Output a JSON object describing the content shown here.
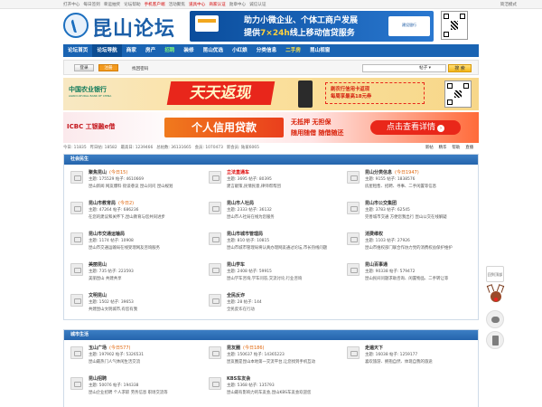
{
  "topbar": {
    "links": [
      "打开中心",
      "每日签到",
      "幸运抽奖",
      "论坛帮助",
      "手机客户端",
      "活动聚焦",
      "道具中心",
      "商家认证",
      "勋章中心",
      "诚信认证"
    ],
    "hot": [
      4,
      6,
      7
    ],
    "right_label": "简洁模式"
  },
  "header": {
    "logo_text": "昆山论坛",
    "banner_line1": "助力小微企业、个体工商户发展",
    "banner_line2_pre": "提供",
    "banner_line2_hl": "7×24h",
    "banner_line2_post": "线上移动信贷服务",
    "banner_bank": "建设银行"
  },
  "nav": {
    "items": [
      {
        "label": "论坛首页",
        "style": ""
      },
      {
        "label": "论坛导航",
        "style": "on"
      },
      {
        "label": "商家",
        "style": ""
      },
      {
        "label": "房产",
        "style": ""
      },
      {
        "label": "招聘",
        "style": "green"
      },
      {
        "label": "装修",
        "style": ""
      },
      {
        "label": "昆山优选",
        "style": ""
      },
      {
        "label": "小红娘",
        "style": ""
      },
      {
        "label": "分类信息",
        "style": ""
      },
      {
        "label": "二手房",
        "style": "yellow"
      },
      {
        "label": "昆山视窗",
        "style": ""
      }
    ]
  },
  "search": {
    "login_label": "登录",
    "register_label": "注册",
    "forgot_label": "找回密码",
    "select_label": "帖子",
    "button_label": "搜 索"
  },
  "ads": {
    "abc_name": "中国农业银行",
    "abc_en": "AGRICULTURAL BANK OF CHINA",
    "abc_headline": "天天返现",
    "abc_line1": "刷农行信用卡返现",
    "abc_line2": "每周享最高18元券",
    "icbc_name": "ICBC 工银融e借",
    "icbc_sub": "",
    "icbc_headline": "个人信用贷款",
    "icbc_slogan1": "无抵押 无担保",
    "icbc_slogan2": "随用随借 随借随还",
    "icbc_cta": "点击查看详情"
  },
  "stats": {
    "today": "今日: 11835",
    "yesterday": "昨日帖: 18582",
    "max": "最高日: 1239466",
    "posts": "总帖数: 36131665",
    "members": "会员: 1070473",
    "new_member": "新会员: 陆家6065",
    "links": [
      "新帖",
      "精华",
      "帮助",
      "直播"
    ]
  },
  "sections": [
    {
      "title": "社会民生",
      "forums": [
        {
          "name": "聚焦昆山",
          "today": "(今日15)",
          "red": false,
          "stat": "主题: 175529  帖子: 4610669",
          "desc": "昆山新闻 网友爆料 街谈巷议 昆山问问 昆山规划"
        },
        {
          "name": "立法直通车",
          "today": "",
          "red": true,
          "stat": "主题: 3695  帖子: 80395",
          "desc": "建言献策,民情民意,律师帮帮团"
        },
        {
          "name": "昆山分类信息",
          "today": "(今日1947)",
          "red": false,
          "stat": "主题: 9155  帖子: 1838576",
          "desc": "房屋租售、招聘、寻事、二手闲置等信息"
        },
        {
          "name": "昆山市教育局",
          "today": "(今日2)",
          "red": false,
          "stat": "主题: 47264  帖子: 686236",
          "desc": "在您的建议和关怀下,昆山教育与您共同进步"
        },
        {
          "name": "昆山市人社局",
          "today": "",
          "red": false,
          "stat": "主题: 2333  帖子: 36132",
          "desc": "昆山市人社局在线为您服务"
        },
        {
          "name": "昆山市公交集团",
          "today": "",
          "red": false,
          "stat": "主题: 3783  帖子: 62545",
          "desc": "完善城市交通 方便您我出行 昆山公交在线解疑"
        },
        {
          "name": "昆山市交通运输局",
          "today": "",
          "red": false,
          "stat": "主题: 1174  帖子: 10908",
          "desc": "昆山市交通运输局在线受理网友咨询服务"
        },
        {
          "name": "昆山市城市管理局",
          "today": "",
          "red": false,
          "stat": "主题: 810  帖子: 10815",
          "desc": "昆山市城市管理局将认真办理网友通过论坛,市长热线问题"
        },
        {
          "name": "消费维权",
          "today": "",
          "red": false,
          "stat": "主题: 1103  帖子: 27926",
          "desc": "昆山市维权部门联合作协力党的消费权益保护维护"
        },
        {
          "name": "美丽昆山",
          "today": "",
          "red": false,
          "stat": "主题: 735  帖子: 223593",
          "desc": "美丽昆山 共建共享"
        },
        {
          "name": "昆山学车",
          "today": "",
          "red": false,
          "stat": "主题: 2408  帖子: 59915",
          "desc": "昆山学车咨询,学车问答,交流讨论,行业咨询"
        },
        {
          "name": "昆山百事通",
          "today": "",
          "red": false,
          "stat": "主题: 90338  帖子: 579472",
          "desc": "昆山民间问题求助咨询、闲置物品、二手转让等"
        },
        {
          "name": "文明昆山",
          "today": "",
          "red": false,
          "stat": "主题: 1502  帖子: 39653",
          "desc": "共建昆山文明城市,有您有我"
        },
        {
          "name": "全民反诈",
          "today": "",
          "red": false,
          "stat": "主题: 28  帖子: 144",
          "desc": "全民反诈在行动"
        }
      ]
    },
    {
      "title": "城市生活",
      "forums": [
        {
          "name": "玉山广场",
          "today": "(今日577)",
          "red": false,
          "stat": "主题: 197902  帖子: 5326531",
          "desc": "昆山最热门人气休闲生活交流"
        },
        {
          "name": "昆友圈",
          "today": "(今日186)",
          "red": false,
          "stat": "主题: 150637  帖子: 14365223",
          "desc": "昆友圈是昆山本地第一交流平台,让您找到手机互动"
        },
        {
          "name": "走遍天下",
          "today": "",
          "red": false,
          "stat": "主题: 16038  帖子: 1259177",
          "desc": "喜欢旅游、拥抱自然、体现自我的旅途"
        },
        {
          "name": "昆山招聘",
          "today": "",
          "red": false,
          "stat": "主题: 50076  帖子: 194338",
          "desc": "昆山企业招聘 个人求职 劳务信息 职场交流等"
        },
        {
          "name": "KBS车友会",
          "today": "",
          "red": false,
          "stat": "主题: 5368  帖子: 135793",
          "desc": "昆山最有影响力的车友会,昆山KBS车友会欢迎您"
        }
      ]
    }
  ],
  "side": {
    "top_label": "回到顶部"
  }
}
